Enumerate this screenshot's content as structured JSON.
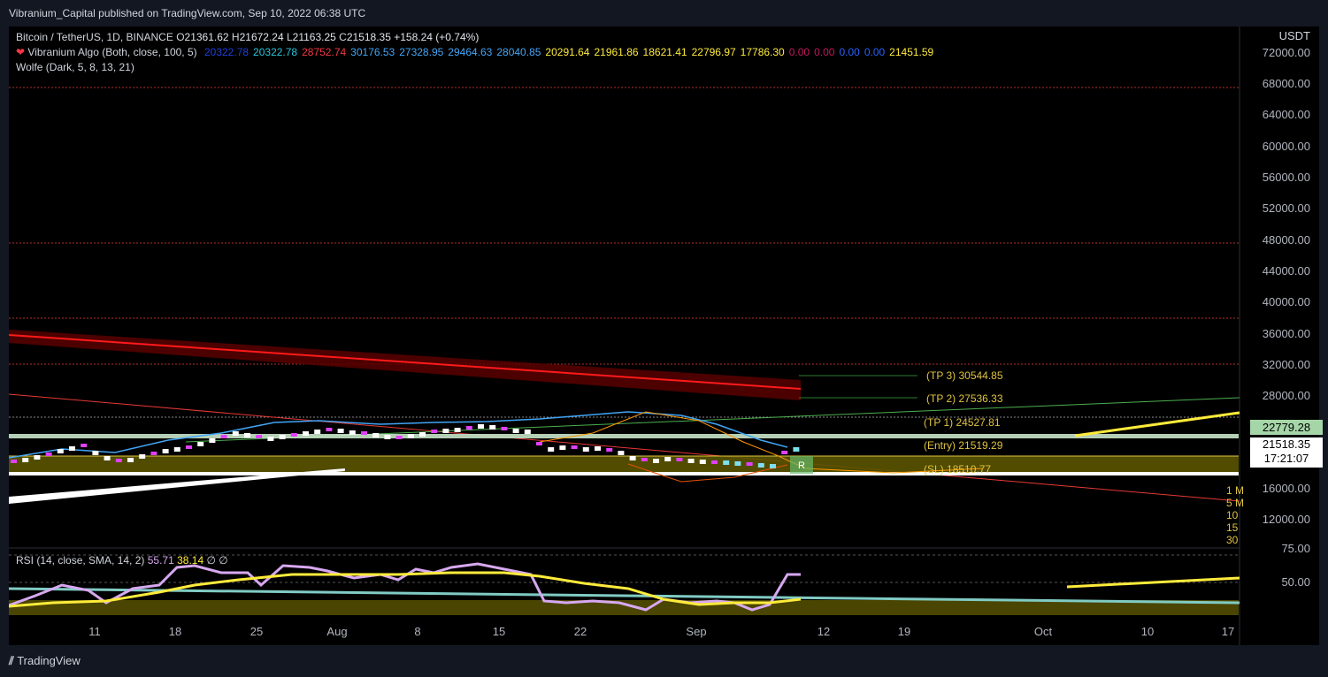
{
  "header": {
    "published": "Vibranium_Capital published on TradingView.com, Sep 10, 2022 06:38 UTC"
  },
  "legend": {
    "symbol": "Bitcoin / TetherUS, 1D, BINANCE",
    "ohlc": [
      {
        "k": "O",
        "v": "21361.62"
      },
      {
        "k": "H",
        "v": "21672.24"
      },
      {
        "k": "L",
        "v": "21163.25"
      },
      {
        "k": "C",
        "v": "21518.35"
      }
    ],
    "change": "+158.24 (+0.74%)",
    "algo_label": "Vibranium Algo (Both, close, 100, 5)",
    "algo_values": [
      {
        "v": "20322.78",
        "c": "#1e3fe0"
      },
      {
        "v": "20322.78",
        "c": "#26c6da"
      },
      {
        "v": "28752.74",
        "c": "#f23645"
      },
      {
        "v": "30176.53",
        "c": "#42a5f5"
      },
      {
        "v": "27328.95",
        "c": "#42a5f5"
      },
      {
        "v": "29464.63",
        "c": "#42a5f5"
      },
      {
        "v": "28040.85",
        "c": "#42a5f5"
      },
      {
        "v": "20291.64",
        "c": "#ffeb3b"
      },
      {
        "v": "21961.86",
        "c": "#ffeb3b"
      },
      {
        "v": "18621.41",
        "c": "#ffeb3b"
      },
      {
        "v": "22796.97",
        "c": "#ffeb3b"
      },
      {
        "v": "17786.30",
        "c": "#ffeb3b"
      },
      {
        "v": "0.00",
        "c": "#c2185b"
      },
      {
        "v": "0.00",
        "c": "#c2185b"
      },
      {
        "v": "0.00",
        "c": "#2962ff"
      },
      {
        "v": "0.00",
        "c": "#2962ff"
      },
      {
        "v": "21451.59",
        "c": "#ffeb3b"
      }
    ],
    "wolfe": "Wolfe (Dark, 5, 8, 13, 21)",
    "rsi": "RSI (14, close, SMA, 14, 2)",
    "rsi_val": "55.71",
    "rsi_sma": "38.14",
    "rsi_extra": "∅ ∅"
  },
  "currency": "USDT",
  "price_axis": [
    "72000.00",
    "68000.00",
    "64000.00",
    "60000.00",
    "56000.00",
    "52000.00",
    "48000.00",
    "44000.00",
    "40000.00",
    "36000.00",
    "32000.00",
    "28000.00",
    "16000.00",
    "12000.00"
  ],
  "rsi_axis": [
    "75.00",
    "50.00"
  ],
  "time_axis": [
    "11",
    "18",
    "25",
    "Aug",
    "8",
    "15",
    "22",
    "Sep",
    "12",
    "19",
    "Oct",
    "10",
    "17"
  ],
  "levels": [
    {
      "label": "(TP 3)",
      "value": "30544.85"
    },
    {
      "label": "(TP 2)",
      "value": "27536.33"
    },
    {
      "label": "(TP 1)",
      "value": "24527.81"
    },
    {
      "label": "(Entry)",
      "value": "21519.29"
    },
    {
      "label": "(SL)",
      "value": "18510.77"
    }
  ],
  "price_tags": {
    "upper": "22779.28",
    "last": "21518.35",
    "countdown": "17:21:07"
  },
  "side_labels": [
    "1 M",
    "5 M",
    "10",
    "15",
    "30"
  ],
  "signal": "R",
  "footer": {
    "brand": "TradingView"
  },
  "colors": {
    "up": "#26c6da",
    "down": "#e040fb",
    "sl_zone": "#e0c341",
    "downtrend": "#ff1a1a",
    "rsi": "#d7a8f0",
    "rsi_sma": "#ffeb3b"
  }
}
